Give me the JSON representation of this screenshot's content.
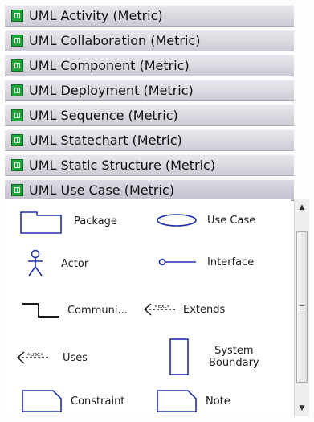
{
  "stencils": [
    {
      "label": "UML Activity (Metric)",
      "icon": "stencil-icon"
    },
    {
      "label": "UML Collaboration (Metric)",
      "icon": "stencil-icon"
    },
    {
      "label": "UML Component (Metric)",
      "icon": "stencil-icon"
    },
    {
      "label": "UML Deployment (Metric)",
      "icon": "stencil-icon"
    },
    {
      "label": "UML Sequence (Metric)",
      "icon": "stencil-icon"
    },
    {
      "label": "UML Statechart (Metric)",
      "icon": "stencil-icon"
    },
    {
      "label": "UML Static Structure (Metric)",
      "icon": "stencil-icon"
    },
    {
      "label": "UML Use Case (Metric)",
      "icon": "stencil-icon"
    }
  ],
  "shapes": {
    "package": {
      "label": "Package",
      "icon": "package-icon"
    },
    "use_case": {
      "label": "Use Case",
      "icon": "ellipse-icon"
    },
    "actor": {
      "label": "Actor",
      "icon": "stick-figure-icon"
    },
    "interface": {
      "label": "Interface",
      "icon": "lollipop-icon"
    },
    "communication": {
      "label": "Communi...",
      "icon": "communication-line-icon"
    },
    "extends": {
      "label": "Extends",
      "icon": "extends-arrow-icon",
      "stereotype": "«ext»"
    },
    "uses": {
      "label": "Uses",
      "icon": "uses-arrow-icon",
      "stereotype": "«use»"
    },
    "system_boundary": {
      "label": "System\nBoundary",
      "icon": "rectangle-icon"
    },
    "constraint": {
      "label": "Constraint",
      "icon": "note-shape-icon"
    },
    "note": {
      "label": "Note",
      "icon": "note-shape-icon"
    }
  },
  "colors": {
    "shape_stroke": "#1f2fb0",
    "stencil_icon": "#1ea53a"
  }
}
